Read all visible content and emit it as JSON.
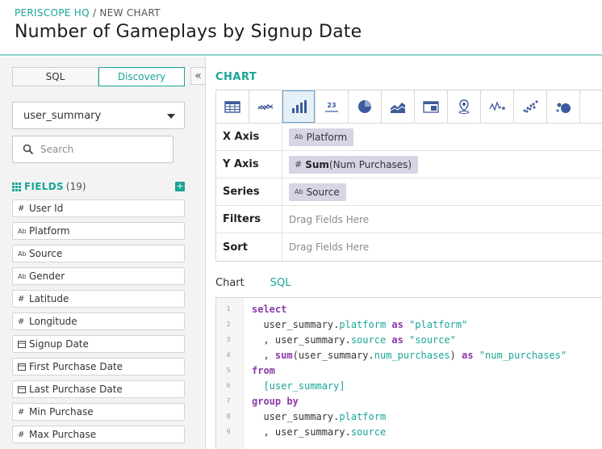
{
  "header": {
    "org": "PERISCOPE HQ",
    "separator": " / ",
    "section": "NEW CHART",
    "title": "Number of Gameplays by Signup Date"
  },
  "sidebar": {
    "modes": [
      {
        "label": "SQL",
        "active": false
      },
      {
        "label": "Discovery",
        "active": true
      }
    ],
    "collapse_glyph": "«",
    "table_select": "user_summary",
    "search_placeholder": "Search",
    "fields_title": "FIELDS",
    "fields_count": "(19)",
    "add_glyph": "+",
    "fields": [
      {
        "type": "#",
        "name": "User Id"
      },
      {
        "type": "Ab",
        "name": "Platform"
      },
      {
        "type": "Ab",
        "name": "Source"
      },
      {
        "type": "Ab",
        "name": "Gender"
      },
      {
        "type": "#",
        "name": "Latitude"
      },
      {
        "type": "#",
        "name": "Longitude"
      },
      {
        "type": "date",
        "name": "Signup Date"
      },
      {
        "type": "date",
        "name": "First Purchase Date"
      },
      {
        "type": "date",
        "name": "Last Purchase Date"
      },
      {
        "type": "#",
        "name": "Min Purchase"
      },
      {
        "type": "#",
        "name": "Max Purchase"
      }
    ]
  },
  "main": {
    "chart_label": "CHART",
    "chart_types": [
      "table-icon",
      "line-icon",
      "bar-icon",
      "number-icon",
      "pie-icon",
      "area-icon",
      "pivot-icon",
      "map-pin-icon",
      "sparkline-icon",
      "scatter-icon",
      "bubble-icon"
    ],
    "active_chart_type": "bar-icon",
    "number_glyph": "23",
    "config": {
      "x_axis": {
        "label": "X Axis",
        "type": "Ab",
        "value": "Platform"
      },
      "y_axis": {
        "label": "Y Axis",
        "type": "#",
        "agg": "Sum",
        "value": "(Num Purchases)"
      },
      "series": {
        "label": "Series",
        "type": "Ab",
        "value": "Source"
      },
      "filters": {
        "label": "Filters",
        "placeholder": "Drag Fields Here"
      },
      "sort": {
        "label": "Sort",
        "placeholder": "Drag Fields Here"
      }
    },
    "tabs": [
      {
        "label": "Chart",
        "active": false
      },
      {
        "label": "SQL",
        "active": true
      }
    ],
    "sql": {
      "l1_kw": "select",
      "l2_pre": "  user_summary.",
      "l2_col": "platform",
      "l2_kw": " as ",
      "l2_str": "\"platform\"",
      "l3_pre": "  , user_summary.",
      "l3_col": "source",
      "l3_kw": " as ",
      "l3_str": "\"source\"",
      "l4_pre": "  , ",
      "l4_fn": "sum",
      "l4_mid": "(user_summary.",
      "l4_col": "num_purchases",
      "l4_end": ")",
      "l4_kw": " as ",
      "l4_str": "\"num_purchases\"",
      "l5_kw": "from",
      "l6_tbl": "  [user_summary]",
      "l7_kw": "group by",
      "l8_pre": "  user_summary.",
      "l8_col": "platform",
      "l9_pre": "  , user_summary.",
      "l9_col": "source",
      "line_numbers": [
        "1",
        "2",
        "3",
        "4",
        "5",
        "6",
        "7",
        "8",
        "9"
      ]
    }
  }
}
